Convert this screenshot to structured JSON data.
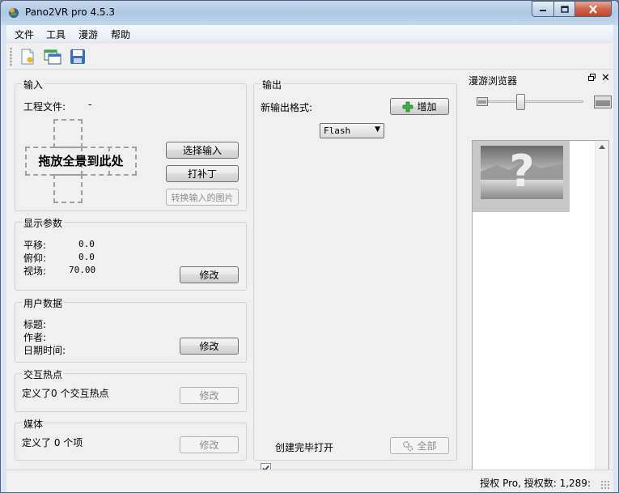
{
  "window": {
    "title": "Pano2VR pro 4.5.3"
  },
  "menu": [
    "文件",
    "工具",
    "漫游",
    "帮助"
  ],
  "input_group": {
    "title": "输入",
    "project_file_label": "工程文件:",
    "project_file_value": "-",
    "drop_text": "拖放全景到此处",
    "select_input": "选择输入",
    "patch": "打补丁",
    "convert": "转换输入的图片"
  },
  "display_group": {
    "title": "显示参数",
    "pan_label": "平移:",
    "pan_value": "0.0",
    "tilt_label": "俯仰:",
    "tilt_value": "0.0",
    "fov_label": "视场:",
    "fov_value": "70.00",
    "modify": "修改"
  },
  "user_group": {
    "title": "用户数据",
    "title_label": "标题:",
    "author_label": "作者:",
    "datetime_label": "日期时间:",
    "modify": "修改"
  },
  "hotspot_group": {
    "title": "交互热点",
    "text": "定义了0 个交互热点",
    "modify": "修改"
  },
  "media_group": {
    "title": "媒体",
    "text": "定义了 0 个项",
    "modify": "修改"
  },
  "output_group": {
    "title": "输出",
    "format_label": "新输出格式:",
    "format_value": "Flash",
    "add": "增加",
    "open_after": "创建完毕打开",
    "all": "全部"
  },
  "dock": {
    "title": "漫游浏览器"
  },
  "status": {
    "text": "授权 Pro, 授权数: 1,289:"
  },
  "colors": {
    "add_icon": "#3cb043",
    "window_frame": "#b9d1ea"
  }
}
